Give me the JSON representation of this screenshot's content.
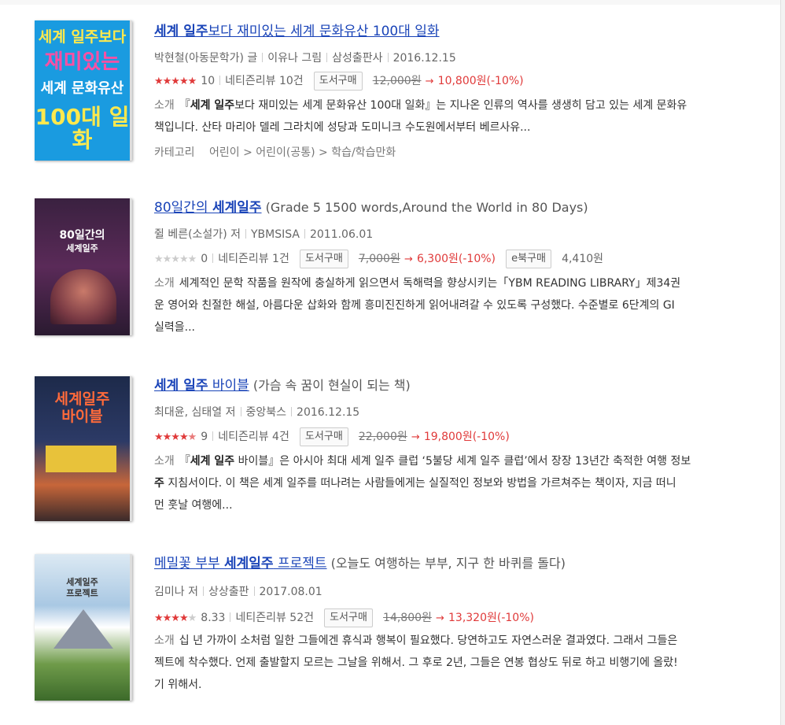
{
  "books": [
    {
      "title_link_parts": [
        "세계 일주",
        "보다 재미있는 세계 문화유산 100대 일화"
      ],
      "subtitle": "",
      "meta": [
        "박현철(아동문학가) 글",
        "이유나 그림",
        "삼성출판사",
        "2016.12.15"
      ],
      "rating_filled": 5,
      "rating_count": "10",
      "review": "네티즌리뷰 10건",
      "buy_label": "도서구매",
      "old_price": "12,000원",
      "arrow": "→",
      "new_price": "10,800원(-10%)",
      "desc_label": "소개",
      "desc_lines": [
        [
          "『",
          "세계 일주",
          "보다 재미있는 세계 문화유산 100대 일화』는 지나온 인류의 역사를 생생히 담고 있는 세계 문화유"
        ],
        [
          "",
          "",
          "책입니다. 산타 마리아 델레 그라치에 성당과 도미니크 수도원에서부터 베르사유..."
        ]
      ],
      "category_label": "카테고리",
      "category_path": "어린이 > 어린이(공통) > 학습/학습만화",
      "cover": {
        "bg": "#1a9be0",
        "lines": [
          "세계 일주보다",
          "재미있는",
          "세계 문화유산",
          "100대 일화"
        ],
        "color": "#ffe94d"
      }
    },
    {
      "title_link_parts": [
        "80일간의 ",
        "세계일주"
      ],
      "subtitle": "(Grade 5 1500 words,Around the World in 80 Days)",
      "meta": [
        "쥘 베른(소설가) 저",
        "YBMSISA",
        "2011.06.01"
      ],
      "rating_filled": 0,
      "rating_count": "0",
      "review": "네티즌리뷰 1건",
      "buy_label": "도서구매",
      "old_price": "7,000원",
      "arrow": "→",
      "new_price": "6,300원(-10%)",
      "ebook_label": "e북구매",
      "ebook_price": "4,410원",
      "desc_label": "소개",
      "desc_lines": [
        [
          "",
          "",
          "세계적인 문학 작품을 원작에 충실하게 읽으면서 독해력을 향상시키는「YBM READING LIBRARY」제34권"
        ],
        [
          "",
          "",
          "운 영어와 친절한 해설, 아름다운 삽화와 함께 흥미진진하게 읽어내려갈 수 있도록 구성했다. 수준별로 6단계의 GI"
        ],
        [
          "",
          "",
          "실력을..."
        ]
      ],
      "cover": {
        "bg": "#3a2140",
        "lines": [
          "80일간의",
          "세계일주"
        ],
        "color": "#ffffff"
      }
    },
    {
      "title_link_parts": [
        "세계 일주",
        " 바이블"
      ],
      "subtitle": "(가슴 속 꿈이 현실이 되는 책)",
      "meta": [
        "최대윤, 심태열 저",
        "중앙북스",
        "2016.12.15"
      ],
      "rating_filled": 4.5,
      "rating_count": "9",
      "review": "네티즌리뷰 4건",
      "buy_label": "도서구매",
      "old_price": "22,000원",
      "arrow": "→",
      "new_price": "19,800원(-10%)",
      "desc_label": "소개",
      "desc_lines": [
        [
          "『",
          "세계 일주",
          " 바이블』은 아시아 최대 세계 일주 클럽 ‘5불당 세계 일주 클럽’에서 장장 13년간 축적한 여행 정보"
        ],
        [
          "",
          "주",
          " 지침서이다. 이 책은 세계 일주를 떠나려는 사람들에게는 실질적인 정보와 방법을 가르쳐주는 책이자, 지금 떠니"
        ],
        [
          "",
          "",
          "먼 훗날 여행에..."
        ]
      ],
      "cover": {
        "bg": "#1d2a4a",
        "lines": [
          "세계일주",
          "바이블"
        ],
        "color": "#ff6a3a"
      }
    },
    {
      "title_link_parts": [
        "메밀꽃 부부 ",
        "세계일주",
        " 프로젝트"
      ],
      "subtitle": "(오늘도 여행하는 부부, 지구 한 바퀴를 돌다)",
      "meta": [
        "김미나 저",
        "상상출판",
        "2017.08.01"
      ],
      "rating_filled": 4,
      "rating_count": "8.33",
      "review": "네티즌리뷰 52건",
      "buy_label": "도서구매",
      "old_price": "14,800원",
      "arrow": "→",
      "new_price": "13,320원(-10%)",
      "desc_label": "소개",
      "desc_lines": [
        [
          "",
          "",
          "십 년 가까이 소처럼 일한 그들에겐 휴식과 행복이 필요했다. 당연하고도 자연스러운 결과였다. 그래서 그들은"
        ],
        [
          "",
          "",
          "젝트에 착수했다. 언제 출발할지 모르는 그날을 위해서. 그 후로 2년, 그들은 연봉 협상도 뒤로 하고 비행기에 올랐!"
        ],
        [
          "",
          "",
          "기 위해서."
        ]
      ],
      "cover": {
        "bg": "#7fb0d8",
        "lines": [
          "세계일주",
          "프로젝트"
        ],
        "color": "#333333"
      }
    }
  ]
}
